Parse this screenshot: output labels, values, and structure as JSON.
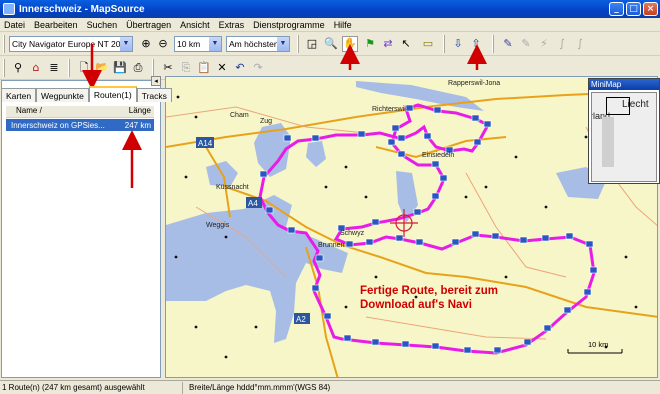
{
  "window": {
    "title": "Innerschweiz - MapSource"
  },
  "menu": [
    "Datei",
    "Bearbeiten",
    "Suchen",
    "Übertragen",
    "Ansicht",
    "Extras",
    "Dienstprogramme",
    "Hilfe"
  ],
  "toolbar": {
    "map_product": "City Navigator Europe NT 2011.4",
    "zoom_scale": "10 km",
    "detail_level": "Am höchsten"
  },
  "left_panel": {
    "tabs": [
      "Karten",
      "Wegpunkte",
      "Routen(1)",
      "Tracks"
    ],
    "active_tab": "Routen(1)",
    "columns": {
      "name": "Name",
      "sort_glyph": "/",
      "length": "Länge"
    },
    "rows": [
      {
        "name": "Innerschweiz on GPSies...",
        "length": "247 km"
      }
    ]
  },
  "map": {
    "place_labels": [
      "Rapperswil-Jona",
      "Richterswil",
      "Cham",
      "Zug",
      "Einsiedeln",
      "Küssnacht",
      "Schwyz",
      "Brunnen",
      "Weggis"
    ],
    "road_badges": [
      "A14",
      "A4",
      "A2"
    ],
    "scale_label": "10 km",
    "route_color": "#e81ce8"
  },
  "minimap": {
    "title": "MiniMap",
    "labels": [
      "Liecht",
      "rland"
    ]
  },
  "annotation": {
    "line1": "Fertige Route, bereit zum",
    "line2": "Download auf's Navi",
    "color": "#d10000"
  },
  "status": {
    "selection": "1 Route(n) (247 km gesamt) ausgewählt",
    "coords": "Breite/Länge hddd°mm.mmm'(WGS 84)"
  }
}
